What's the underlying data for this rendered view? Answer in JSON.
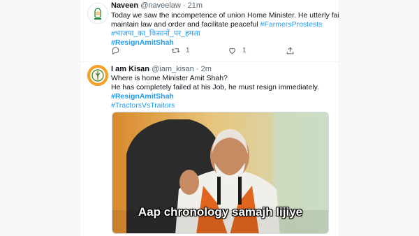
{
  "tweets": [
    {
      "name": "Naveen",
      "handle": "@naveelaw",
      "separator": "·",
      "time": "21m",
      "lines": [
        "Today we saw the incompetence of union Home Minister. He utterly failed to",
        "maintain law and order and facilitate peaceful"
      ],
      "inline_hashtag": "#FarmersProstests",
      "hashtag_hindi": "#भाजपा_का_किसानों_पर_हमला",
      "hashtag_bold": "#ResignAmitShah",
      "reply_count": "",
      "retweet_count": "1",
      "like_count": "1",
      "avatar_icon": "party-logo-icon"
    },
    {
      "name": "I am Kisan",
      "handle": "@iam_kisan",
      "separator": "·",
      "time": "2m",
      "lines": [
        "Where is home Minister Amit Shah?",
        "He has completely failed at his Job, he must resign immediately."
      ],
      "hashtag_bold": "#ResignAmitShah",
      "hashtag_2": "#TractorsVsTraitors",
      "avatar_icon": "kisan-logo-icon",
      "media_caption": "Aap chronology samajh lijiye"
    }
  ],
  "colors": {
    "link": "#1d9bf0",
    "text": "#0f1419",
    "muted": "#536471"
  }
}
